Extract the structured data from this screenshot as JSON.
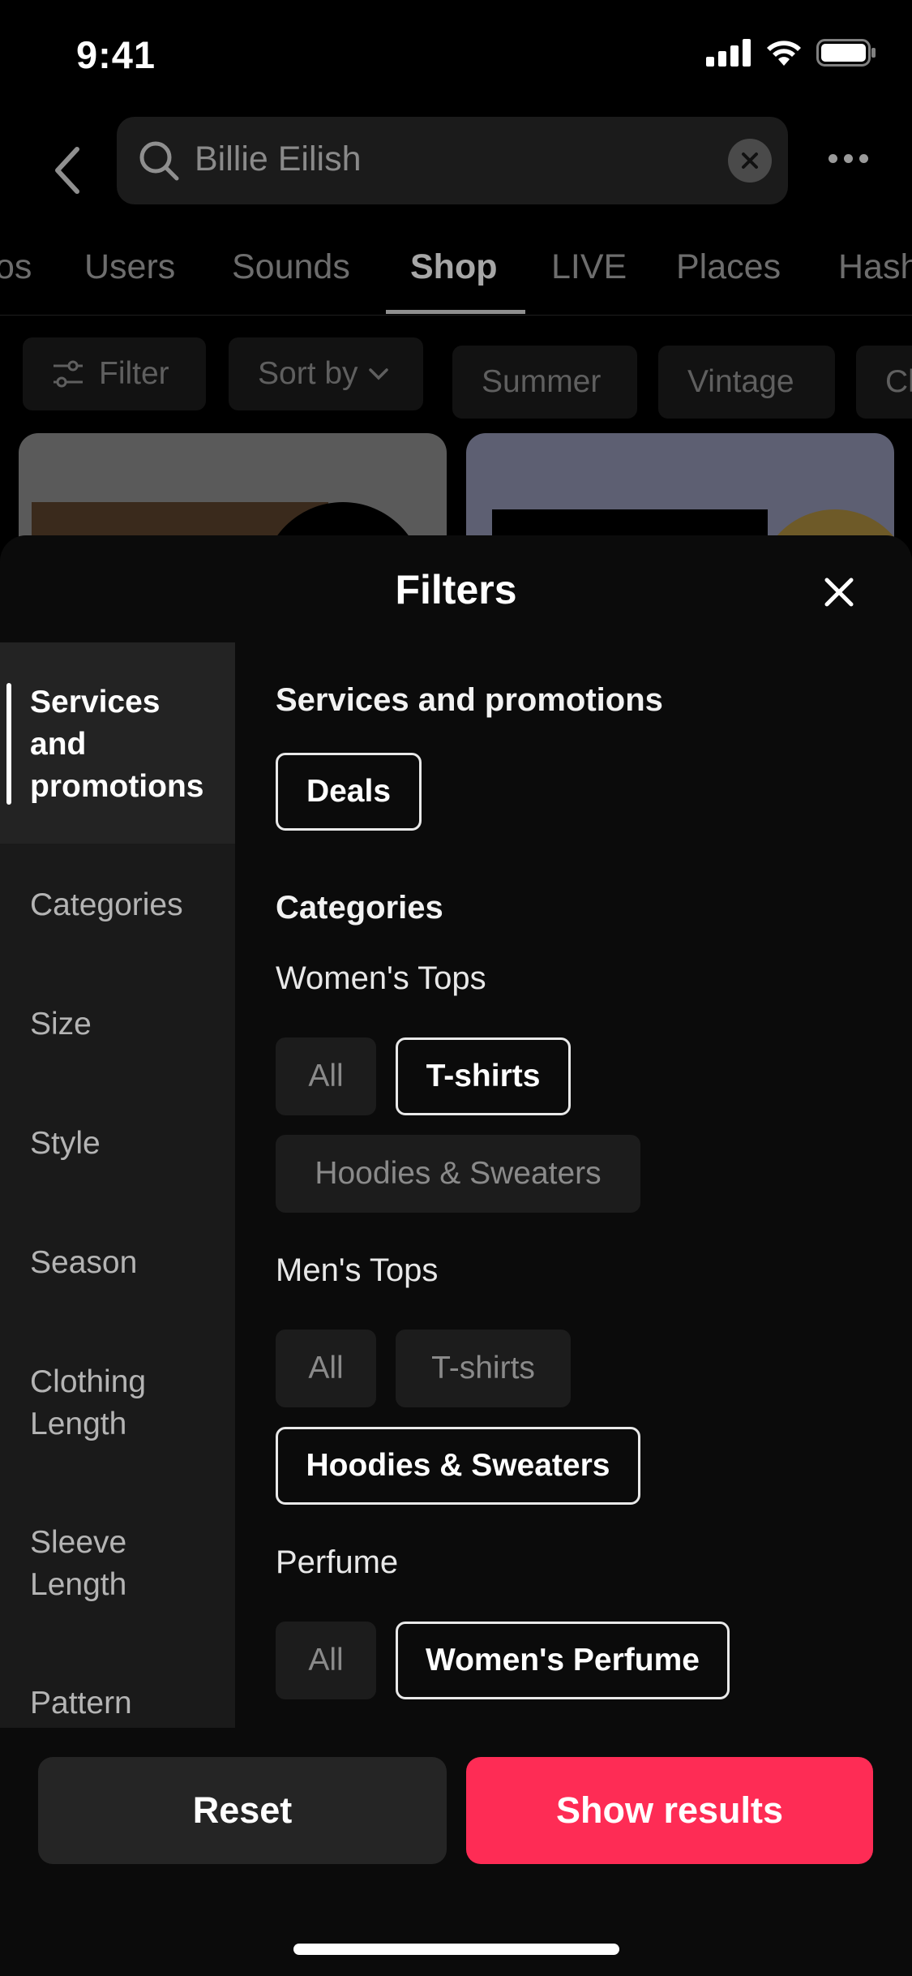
{
  "status": {
    "time": "9:41"
  },
  "search": {
    "query": "Billie Eilish"
  },
  "tabs": [
    {
      "label": "os"
    },
    {
      "label": "Users"
    },
    {
      "label": "Sounds"
    },
    {
      "label": "Shop"
    },
    {
      "label": "LIVE"
    },
    {
      "label": "Places"
    },
    {
      "label": "Hash"
    }
  ],
  "active_tab": "Shop",
  "chips": [
    {
      "label": "Filter"
    },
    {
      "label": "Sort by"
    },
    {
      "label": "Summer"
    },
    {
      "label": "Vintage"
    },
    {
      "label": "Cl"
    }
  ],
  "sheet": {
    "title": "Filters"
  },
  "sidebar": [
    {
      "label": "Services and promotions",
      "active": true
    },
    {
      "label": "Categories"
    },
    {
      "label": "Size"
    },
    {
      "label": "Style"
    },
    {
      "label": "Season"
    },
    {
      "label": "Clothing Length"
    },
    {
      "label": "Sleeve Length"
    },
    {
      "label": "Pattern"
    }
  ],
  "sections": {
    "services": {
      "title": "Services and promotions",
      "options": [
        {
          "label": "Deals",
          "selected": true
        }
      ]
    },
    "categories": {
      "title": "Categories",
      "womens_tops": {
        "title": "Women's Tops",
        "options": [
          {
            "label": "All",
            "selected": false
          },
          {
            "label": "T-shirts",
            "selected": true
          },
          {
            "label": "Hoodies & Sweaters",
            "selected": false
          }
        ]
      },
      "mens_tops": {
        "title": "Men's Tops",
        "options": [
          {
            "label": "All",
            "selected": false
          },
          {
            "label": "T-shirts",
            "selected": false
          },
          {
            "label": "Hoodies & Sweaters",
            "selected": true
          }
        ]
      },
      "perfume": {
        "title": "Perfume",
        "options": [
          {
            "label": "All",
            "selected": false
          },
          {
            "label": "Women's Perfume",
            "selected": true
          }
        ]
      }
    }
  },
  "buttons": {
    "reset": "Reset",
    "show": "Show results"
  },
  "colors": {
    "accent": "#fe2c55",
    "sheet_bg": "#0b0b0b",
    "sidebar_bg": "#1a1a1a"
  }
}
